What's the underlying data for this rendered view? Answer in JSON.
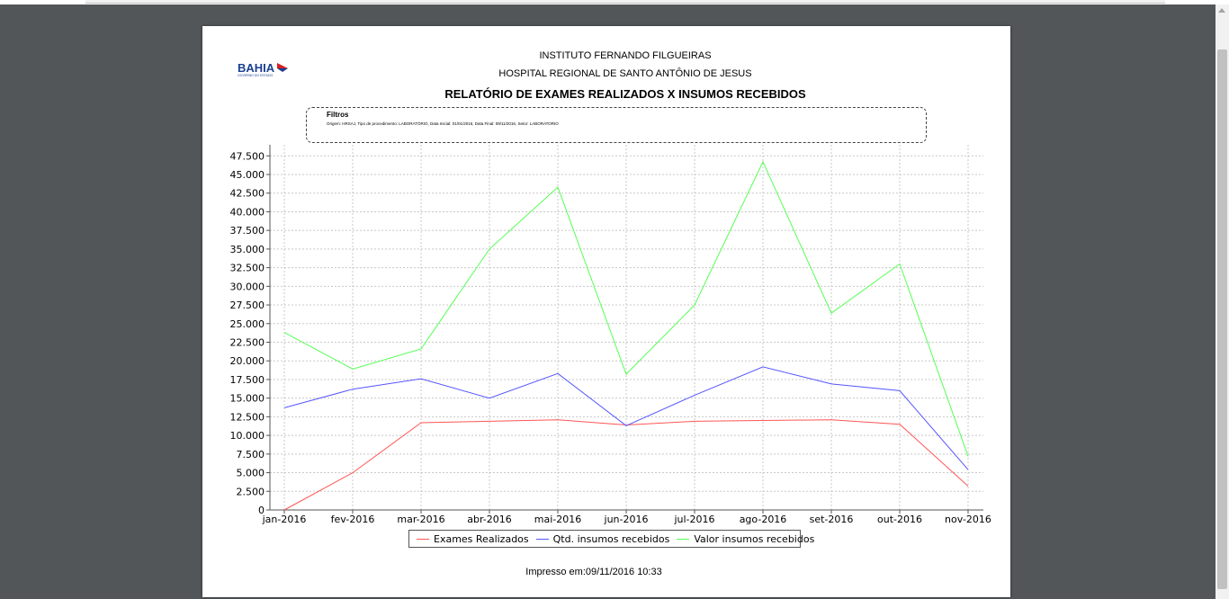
{
  "header": {
    "institute": "INSTITUTO FERNANDO FILGUEIRAS",
    "hospital": "HOSPITAL REGIONAL DE SANTO ANTÔNIO DE JESUS",
    "title": "RELATÓRIO DE EXAMES REALIZADOS X INSUMOS RECEBIDOS"
  },
  "logo": {
    "text": "BAHIA",
    "subtext": "GOVERNO DO ESTADO"
  },
  "filters": {
    "title": "Filtros",
    "text": "Origem: HRSAJ, Tipo de procedimento: LABORATÓRIO, Data Inicial: 01/01/2016, Data Final: 09/11/2016, Setor: LABORATORIO"
  },
  "footer": {
    "printed": "Impresso em:09/11/2016 10:33"
  },
  "colors": {
    "exames": "#ff5555",
    "qtd": "#5555ff",
    "valor": "#55ff55"
  },
  "chart_data": {
    "type": "line",
    "categories": [
      "jan-2016",
      "fev-2016",
      "mar-2016",
      "abr-2016",
      "mai-2016",
      "jun-2016",
      "jul-2016",
      "ago-2016",
      "set-2016",
      "out-2016",
      "nov-2016"
    ],
    "y_ticks": [
      "0",
      "2.500",
      "5.000",
      "7.500",
      "10.000",
      "12.500",
      "15.000",
      "17.500",
      "20.000",
      "22.500",
      "25.000",
      "27.500",
      "30.000",
      "32.500",
      "35.000",
      "37.500",
      "40.000",
      "42.500",
      "45.000",
      "47.500"
    ],
    "ylim": [
      0,
      48500
    ],
    "grid": true,
    "legend": "bottom",
    "series": [
      {
        "name": "Exames Realizados",
        "values": [
          0,
          5000,
          11700,
          11900,
          12100,
          11400,
          11900,
          12000,
          12100,
          11500,
          3200
        ]
      },
      {
        "name": "Qtd. insumos recebidos",
        "values": [
          13700,
          16200,
          17600,
          15000,
          18300,
          11300,
          15400,
          19200,
          16900,
          16000,
          5400
        ]
      },
      {
        "name": "Valor insumos recebidos",
        "values": [
          23800,
          18900,
          21600,
          35000,
          43300,
          18200,
          27500,
          46700,
          26400,
          33000,
          7200
        ]
      }
    ]
  }
}
